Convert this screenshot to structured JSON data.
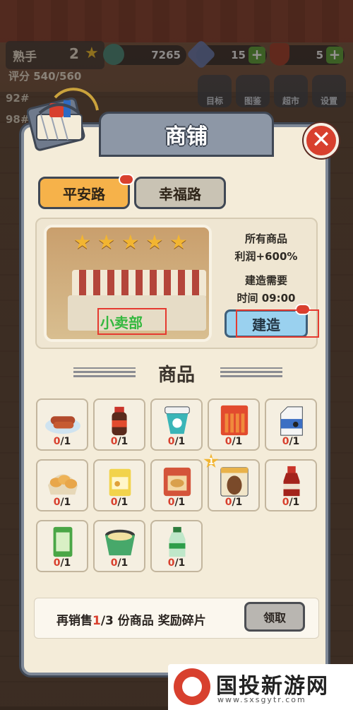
{
  "hud": {
    "rank_label": "熟手",
    "rank_level": "2",
    "score": "评分 540/560",
    "coins": "7265",
    "gems": "15",
    "tickets": "5",
    "side_list": [
      "92#",
      "98#"
    ],
    "icons": [
      "目标",
      "图鉴",
      "超市",
      "设置"
    ]
  },
  "panel": {
    "title": "商铺",
    "tabs": [
      "平安路",
      "幸福路"
    ],
    "shop": {
      "name": "小卖部",
      "stars": 5,
      "info_line1": "所有商品",
      "info_line2": "利润+600%",
      "build_need": "建造需要",
      "build_time": "时间 09:00",
      "build_button": "建造"
    },
    "goods_title": "商品",
    "goods": [
      {
        "icon": "sausage-plate-icon",
        "count": "0/1"
      },
      {
        "icon": "cola-bottle-icon",
        "count": "0/1"
      },
      {
        "icon": "yogurt-cup-icon",
        "count": "0/1"
      },
      {
        "icon": "sausage-pack-icon",
        "count": "0/1"
      },
      {
        "icon": "milk-carton-icon",
        "count": "0/1"
      },
      {
        "icon": "bread-bag-icon",
        "count": "0/1"
      },
      {
        "icon": "snack-bag-icon",
        "count": "0/1"
      },
      {
        "icon": "chips-bag-icon",
        "count": "0/1"
      },
      {
        "icon": "egg-pack-icon",
        "count": "0/1",
        "badge": "1"
      },
      {
        "icon": "soda-bottle-icon",
        "count": "0/1"
      },
      {
        "icon": "gum-pack-icon",
        "count": "0/1"
      },
      {
        "icon": "instant-noodle-icon",
        "count": "0/1"
      },
      {
        "icon": "water-bottle-icon",
        "count": "0/1"
      }
    ],
    "reward": {
      "prefix": "再销售",
      "progress": "1",
      "total": "/3",
      "suffix": " 份商品  奖励碎片",
      "claim_button": "领取"
    }
  },
  "watermark": {
    "title": "国投新游网",
    "url": "www.sxsgytr.com"
  },
  "colors": {
    "panel_bg": "#f4ecd9",
    "header": "#8d97a6",
    "accent_red": "#d8402e",
    "tab_active": "#f6b24a",
    "build_button": "#9ad1ef",
    "shop_name_green": "#34b83f"
  }
}
